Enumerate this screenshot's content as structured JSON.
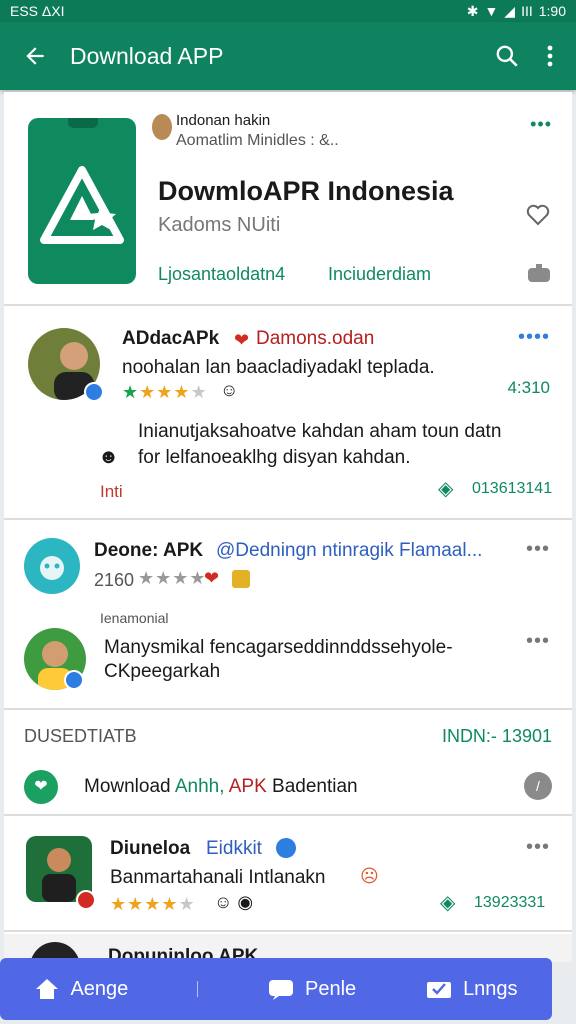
{
  "status_bar": {
    "left": "ESS ΔXI",
    "right_time": "1:90",
    "battery_text": "ΙΙΙ"
  },
  "app_bar": {
    "title": "Download APP",
    "back_icon": "arrow-left-icon",
    "search_icon": "search-icon",
    "menu_icon": "more-vert-icon"
  },
  "hero": {
    "developer_name": "Indonan hakin",
    "developer_sub": "Aomatlim Minidles : &..",
    "title": "DowmloAPR Indonesia",
    "subtitle": "Kadoms NUiti",
    "tag_left": "Ljosantaoldatn4",
    "tag_right": "Inciuderdiam",
    "more_dots": "•••"
  },
  "review1": {
    "name": "ADdacAPk",
    "handle": "Damons.odan",
    "text": "noohalan lan baacladiyadakl teplada.",
    "stars": "4",
    "count": "4:310",
    "reply_text_1": "Inianutjaksahoatve kahdan aham toun datn",
    "reply_text_2": "for lelfanoeaklhg disyan kahdan.",
    "reply_label": "Inti",
    "reply_count": "013613141",
    "more_dots": "••••"
  },
  "review2": {
    "name": "Deone: APK",
    "handle": "@Dedningn ntinragik Flamaal...",
    "rating_text": "2160",
    "subhead": "Ienamonial",
    "text_1": "Manysmikal fencagarseddinnddssehyole-",
    "text_2": "CKpeegarkah",
    "more_dots": "•••"
  },
  "section": {
    "label": "DUSEDTIATB",
    "right": "INDN:- 13901",
    "link_text_1": "Mownload",
    "link_text_2": "Anhh,",
    "link_text_3": "APK",
    "link_text_4": "Badentian"
  },
  "review3": {
    "name": "Diuneloa",
    "tag": "Eidkkit",
    "text": "Banmartahanali Intlanakn",
    "count": "13923331",
    "more_dots": "•••"
  },
  "peek_label": "Dopuninloo APK",
  "bottom_nav": {
    "item_1": "Aenge",
    "item_2": "Penle",
    "item_3": "Lnngs"
  },
  "colors": {
    "primary": "#0f8360",
    "nav": "#5168e6",
    "star": "#f1a21b",
    "link": "#0f8a5f"
  }
}
